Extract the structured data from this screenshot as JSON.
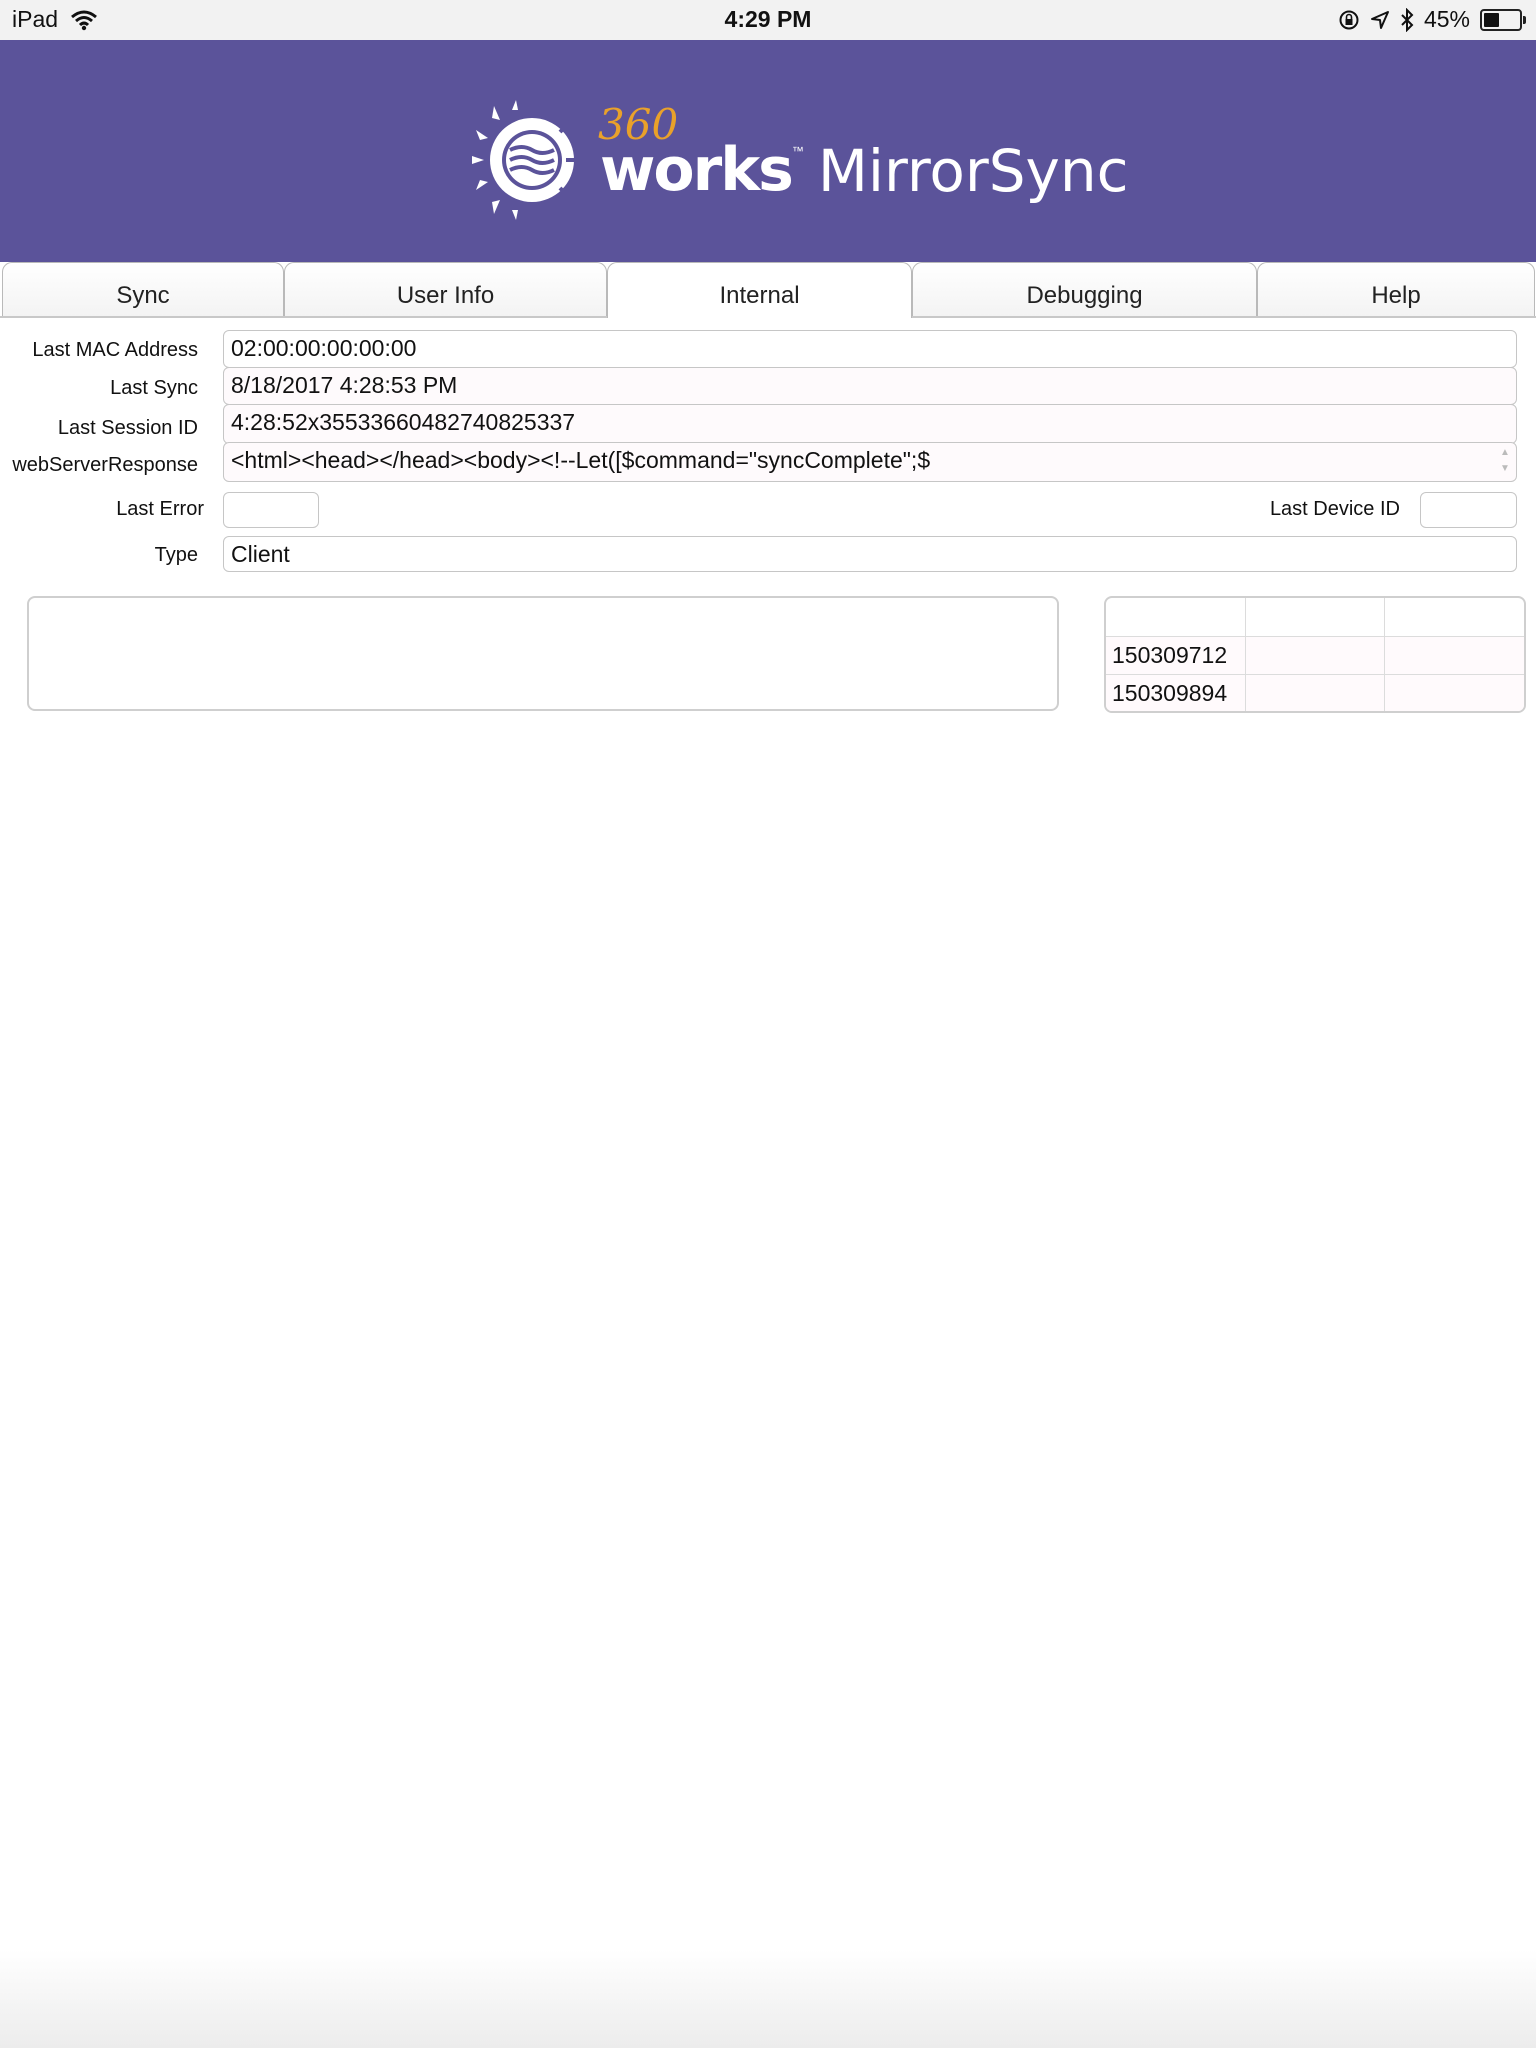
{
  "status_bar": {
    "device": "iPad",
    "time": "4:29 PM",
    "battery_percent": "45%",
    "battery_level": 0.45
  },
  "header": {
    "logo_360": "360",
    "logo_works": "works",
    "logo_tm": "™",
    "logo_product": "MirrorSync",
    "brand_color": "#5b539a",
    "accent_color": "#e9a12a"
  },
  "tabs": [
    {
      "label": "Sync",
      "active": false
    },
    {
      "label": "User Info",
      "active": false
    },
    {
      "label": "Internal",
      "active": true
    },
    {
      "label": "Debugging",
      "active": false
    },
    {
      "label": "Help",
      "active": false
    }
  ],
  "form": {
    "last_mac_label": "Last MAC Address",
    "last_mac_value": "02:00:00:00:00:00",
    "last_sync_label": "Last Sync",
    "last_sync_value": "8/18/2017 4:28:53 PM",
    "last_session_label": "Last Session ID",
    "last_session_value": "4:28:52x35533660482740825337",
    "web_response_label": "webServerResponse",
    "web_response_value": "<html><head></head><body><!--Let([$command=\"syncComplete\";$",
    "last_error_label": "Last Error",
    "last_error_value": "",
    "last_device_label": "Last Device ID",
    "last_device_value": "",
    "type_label": "Type",
    "type_value": "Client"
  },
  "portal": {
    "rows": [
      {
        "col1": "150309712",
        "col2": "",
        "col3": ""
      },
      {
        "col1": "150309894",
        "col2": "",
        "col3": ""
      }
    ]
  }
}
